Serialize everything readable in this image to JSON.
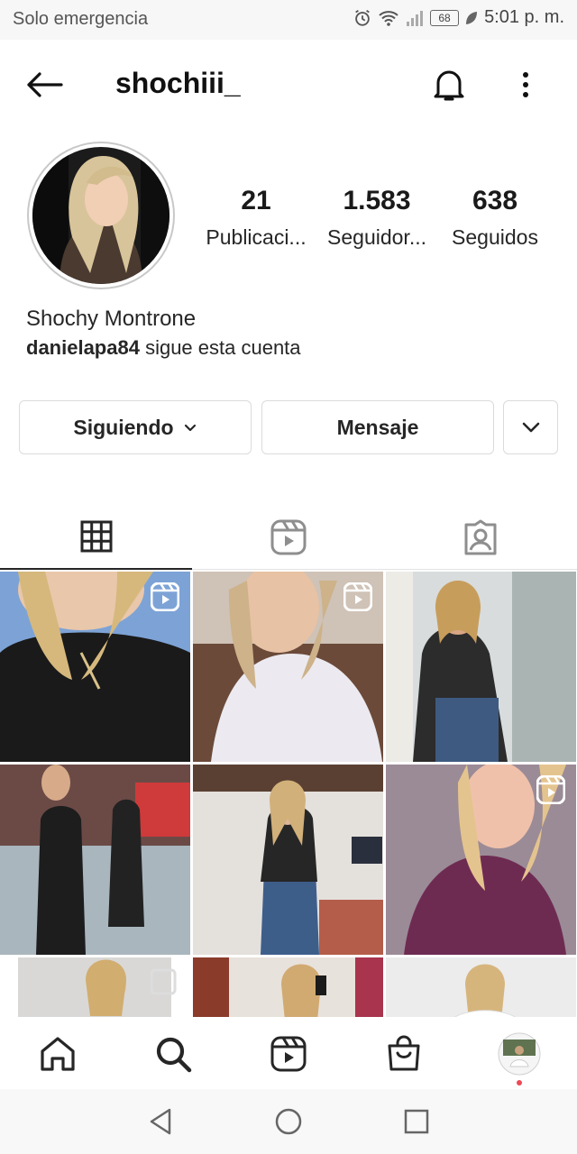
{
  "status_bar": {
    "carrier": "Solo emergencia",
    "battery": "68",
    "time": "5:01 p. m.",
    "icons": [
      "alarm-icon",
      "wifi-icon",
      "signal-icon",
      "battery-icon",
      "leaf-icon"
    ]
  },
  "header": {
    "username": "shochiii_",
    "icons": [
      "back-arrow-icon",
      "bell-icon",
      "more-vertical-icon"
    ]
  },
  "profile": {
    "stats": [
      {
        "number": "21",
        "label": "Publicaci..."
      },
      {
        "number": "1.583",
        "label": "Seguidor..."
      },
      {
        "number": "638",
        "label": "Seguidos"
      }
    ],
    "full_name": "Shochy Montrone",
    "followed_by_user": "danielapa84",
    "followed_by_text": "sigue esta cuenta"
  },
  "actions": {
    "following_label": "Siguiendo",
    "message_label": "Mensaje"
  },
  "tabs": [
    {
      "icon": "grid-icon",
      "active": true
    },
    {
      "icon": "reels-icon",
      "active": false
    },
    {
      "icon": "tagged-icon",
      "active": false
    }
  ],
  "colors": {
    "accent": "#262626",
    "border": "#dbdbdb",
    "notification_dot": "#ed4956"
  },
  "bottom_nav": [
    "home-icon",
    "search-icon",
    "reels-icon",
    "shop-icon",
    "profile-avatar"
  ],
  "android_nav": [
    "back-triangle-icon",
    "home-circle-icon",
    "recents-square-icon"
  ]
}
